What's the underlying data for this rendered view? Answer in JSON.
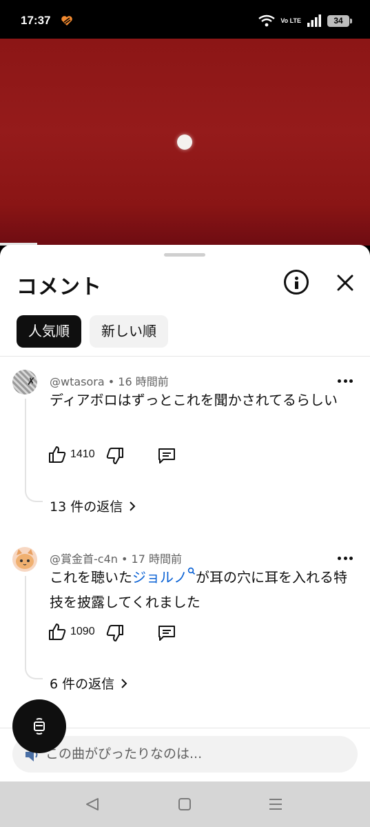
{
  "status_bar": {
    "time": "17:37",
    "network": "Vo LTE",
    "battery": "34"
  },
  "video": {
    "background_color": "#8c1616",
    "progress_fraction": 0.1
  },
  "sheet": {
    "title": "コメント",
    "info_icon": "info-circle-icon",
    "close_icon": "close-icon",
    "sort_chips": [
      {
        "label": "人気順",
        "active": true
      },
      {
        "label": "新しい順",
        "active": false
      }
    ]
  },
  "comments": [
    {
      "author": "@wtasora",
      "separator": " • ",
      "time": "16 時間前",
      "text": "ディアボロはずっとこれを聞かされてるらしい",
      "likes": "1410",
      "replies": "13 件の返信"
    },
    {
      "author": "@賞金首-c4n",
      "separator": " • ",
      "time": "17 時間前",
      "text_before": "これを聴いた",
      "text_link": "ジョルノ",
      "text_after": "が耳の穴に耳を入れる特技を披露してくれました",
      "likes": "1090",
      "replies": "6 件の返信"
    }
  ],
  "comment_input": {
    "placeholder": "この曲がぴったりなのは..."
  },
  "nav": {
    "back_icon": "back-triangle-icon",
    "home_icon": "home-square-icon",
    "recents_icon": "menu-lines-icon"
  }
}
